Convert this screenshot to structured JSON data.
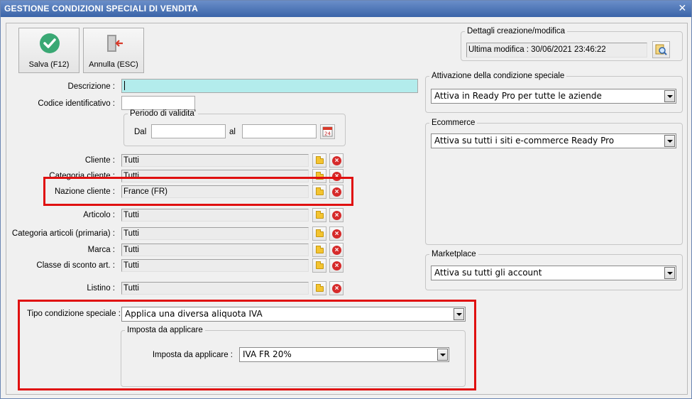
{
  "window": {
    "title": "GESTIONE CONDIZIONI SPECIALI DI VENDITA",
    "close_label": "✕"
  },
  "toolbar": {
    "save_label": "Salva (F12)",
    "cancel_label": "Annulla (ESC)"
  },
  "form": {
    "descrizione_label": "Descrizione :",
    "descrizione_value": "",
    "codice_label": "Codice identificativo :",
    "codice_value": "",
    "periodo": {
      "legend": "Periodo di validita'",
      "dal_label": "Dal",
      "dal_value": "",
      "al_label": "al",
      "al_value": "",
      "calendar_day": "24"
    },
    "rows": [
      {
        "label": "Cliente :",
        "value": "Tutti"
      },
      {
        "label": "Categoria cliente :",
        "value": "Tutti"
      },
      {
        "label": "Nazione cliente :",
        "value": "France (FR)"
      },
      {
        "label": "Articolo :",
        "value": "Tutti"
      },
      {
        "label": "Categoria articoli (primaria) :",
        "value": "Tutti"
      },
      {
        "label": "Marca :",
        "value": "Tutti"
      },
      {
        "label": "Classe di sconto art. :",
        "value": "Tutti"
      },
      {
        "label": "Listino :",
        "value": "Tutti"
      }
    ],
    "tipo_label": "Tipo condizione speciale :",
    "tipo_value": "Applica una diversa aliquota IVA",
    "imposta_group": {
      "legend": "Imposta da applicare",
      "label": "Imposta da applicare :",
      "value": "IVA FR 20%"
    }
  },
  "right": {
    "dettagli": {
      "legend": "Dettagli creazione/modifica",
      "value": "Ultima modifica : 30/06/2021  23:46:22"
    },
    "attivazione": {
      "legend": "Attivazione della condizione speciale",
      "value": "Attiva in Ready Pro per tutte le aziende"
    },
    "ecommerce": {
      "legend": "Ecommerce",
      "value": "Attiva su tutti i siti e-commerce Ready Pro"
    },
    "marketplace": {
      "legend": "Marketplace",
      "value": "Attiva su tutti gli account"
    }
  },
  "colors": {
    "highlight": "#e01010",
    "input_focus": "#b3ecec",
    "titlebar": "#4a74b8"
  }
}
